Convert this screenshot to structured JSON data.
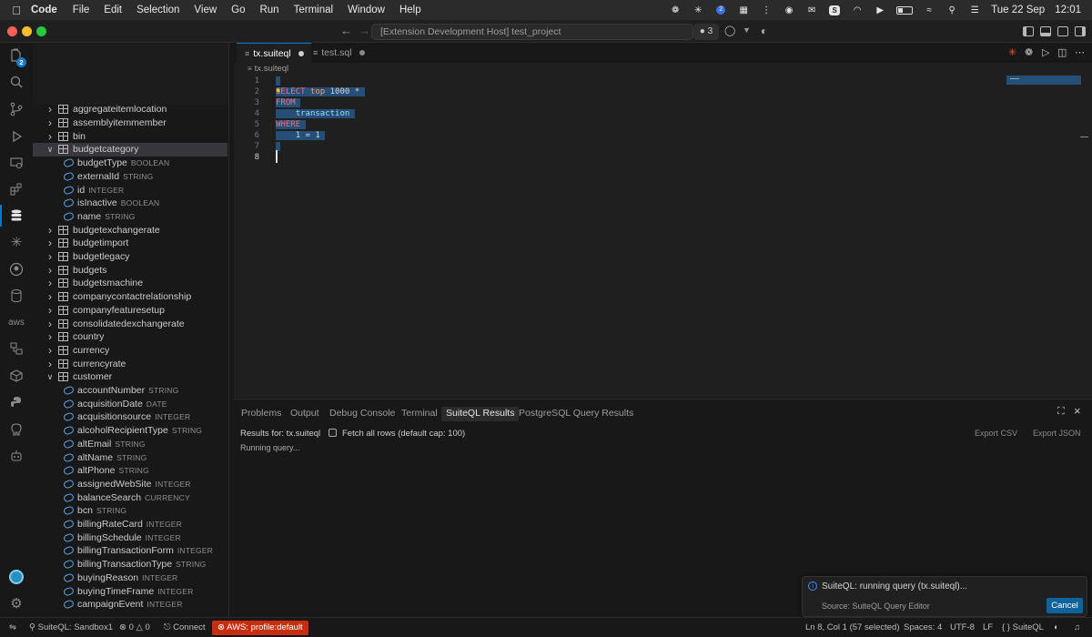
{
  "menubar": {
    "app_name": "Code",
    "items": [
      "File",
      "Edit",
      "Selection",
      "View",
      "Go",
      "Run",
      "Terminal",
      "Window",
      "Help"
    ],
    "badge": "2",
    "date": "Tue 22 Sep",
    "time": "12:01"
  },
  "titlebar": {
    "command_center": "[Extension Development Host] test_project",
    "badge": "3"
  },
  "activitybar": {
    "explorer_badge": "2",
    "aws_label": "aws"
  },
  "sidebar": {
    "rows": [
      {
        "kind": "table",
        "label": "aggregateitemlocation",
        "expanded": false
      },
      {
        "kind": "table",
        "label": "assemblyitemmember",
        "expanded": false
      },
      {
        "kind": "table",
        "label": "bin",
        "expanded": false
      },
      {
        "kind": "table",
        "label": "budgetcategory",
        "expanded": true,
        "selected": true
      },
      {
        "kind": "field",
        "label": "budgetType",
        "type": "BOOLEAN"
      },
      {
        "kind": "field",
        "label": "externalId",
        "type": "STRING"
      },
      {
        "kind": "field",
        "label": "id",
        "type": "INTEGER"
      },
      {
        "kind": "field",
        "label": "isInactive",
        "type": "BOOLEAN"
      },
      {
        "kind": "field",
        "label": "name",
        "type": "STRING"
      },
      {
        "kind": "table",
        "label": "budgetexchangerate",
        "expanded": false
      },
      {
        "kind": "table",
        "label": "budgetimport",
        "expanded": false
      },
      {
        "kind": "table",
        "label": "budgetlegacy",
        "expanded": false
      },
      {
        "kind": "table",
        "label": "budgets",
        "expanded": false
      },
      {
        "kind": "table",
        "label": "budgetsmachine",
        "expanded": false
      },
      {
        "kind": "table",
        "label": "companycontactrelationship",
        "expanded": false
      },
      {
        "kind": "table",
        "label": "companyfeaturesetup",
        "expanded": false
      },
      {
        "kind": "table",
        "label": "consolidatedexchangerate",
        "expanded": false
      },
      {
        "kind": "table",
        "label": "country",
        "expanded": false
      },
      {
        "kind": "table",
        "label": "currency",
        "expanded": false
      },
      {
        "kind": "table",
        "label": "currencyrate",
        "expanded": false
      },
      {
        "kind": "table",
        "label": "customer",
        "expanded": true
      },
      {
        "kind": "field",
        "label": "accountNumber",
        "type": "STRING"
      },
      {
        "kind": "field",
        "label": "acquisitionDate",
        "type": "DATE"
      },
      {
        "kind": "field",
        "label": "acquisitionsource",
        "type": "INTEGER"
      },
      {
        "kind": "field",
        "label": "alcoholRecipientType",
        "type": "STRING"
      },
      {
        "kind": "field",
        "label": "altEmail",
        "type": "STRING"
      },
      {
        "kind": "field",
        "label": "altName",
        "type": "STRING"
      },
      {
        "kind": "field",
        "label": "altPhone",
        "type": "STRING"
      },
      {
        "kind": "field",
        "label": "assignedWebSite",
        "type": "INTEGER"
      },
      {
        "kind": "field",
        "label": "balanceSearch",
        "type": "CURRENCY"
      },
      {
        "kind": "field",
        "label": "bcn",
        "type": "STRING"
      },
      {
        "kind": "field",
        "label": "billingRateCard",
        "type": "INTEGER"
      },
      {
        "kind": "field",
        "label": "billingSchedule",
        "type": "INTEGER"
      },
      {
        "kind": "field",
        "label": "billingTransactionForm",
        "type": "INTEGER"
      },
      {
        "kind": "field",
        "label": "billingTransactionType",
        "type": "STRING"
      },
      {
        "kind": "field",
        "label": "buyingReason",
        "type": "INTEGER"
      },
      {
        "kind": "field",
        "label": "buyingTimeFrame",
        "type": "INTEGER"
      },
      {
        "kind": "field",
        "label": "campaignEvent",
        "type": "INTEGER"
      }
    ]
  },
  "editor": {
    "tabs": [
      {
        "label": "tx.suiteql",
        "active": true,
        "dirty": true
      },
      {
        "label": "test.sql",
        "active": false,
        "dirty": true
      }
    ],
    "breadcrumb": "tx.suiteql",
    "line_numbers": [
      "1",
      "2",
      "3",
      "4",
      "5",
      "6",
      "7",
      "8"
    ],
    "code": {
      "l2_kw1": "SELECT",
      "l2_kw2": "top",
      "l2_num": "1000",
      "l2_star": "*",
      "l3_kw": "FROM",
      "l4_table": "transaction",
      "l5_kw": "WHERE",
      "l6_expr": "1 = 1"
    }
  },
  "panel": {
    "tabs": [
      "Problems",
      "Output",
      "Debug Console",
      "Terminal",
      "SuiteQL Results",
      "PostgreSQL Query Results"
    ],
    "active_tab": "SuiteQL Results",
    "results_for": "Results for: tx.suiteql",
    "fetch_all_label": "Fetch all rows (default cap: 100)",
    "export_csv": "Export CSV",
    "export_json": "Export JSON",
    "status": "Running query..."
  },
  "notification": {
    "message": "SuiteQL: running query (tx.suiteql)...",
    "source": "Source: SuiteQL Query Editor",
    "cancel_label": "Cancel"
  },
  "statusbar": {
    "connection": "SuiteQL: Sandbox1",
    "errors": "0",
    "warnings": "0",
    "connect": "Connect",
    "aws": "AWS: profile:default",
    "position": "Ln 8, Col 1 (57 selected)",
    "spaces": "Spaces: 4",
    "encoding": "UTF-8",
    "eol": "LF",
    "language": "SuiteQL"
  },
  "colors": {
    "accent": "#0078d4",
    "aws_badge": "#c72e0f",
    "selection": "#264f78",
    "keyword": "#f07178"
  }
}
